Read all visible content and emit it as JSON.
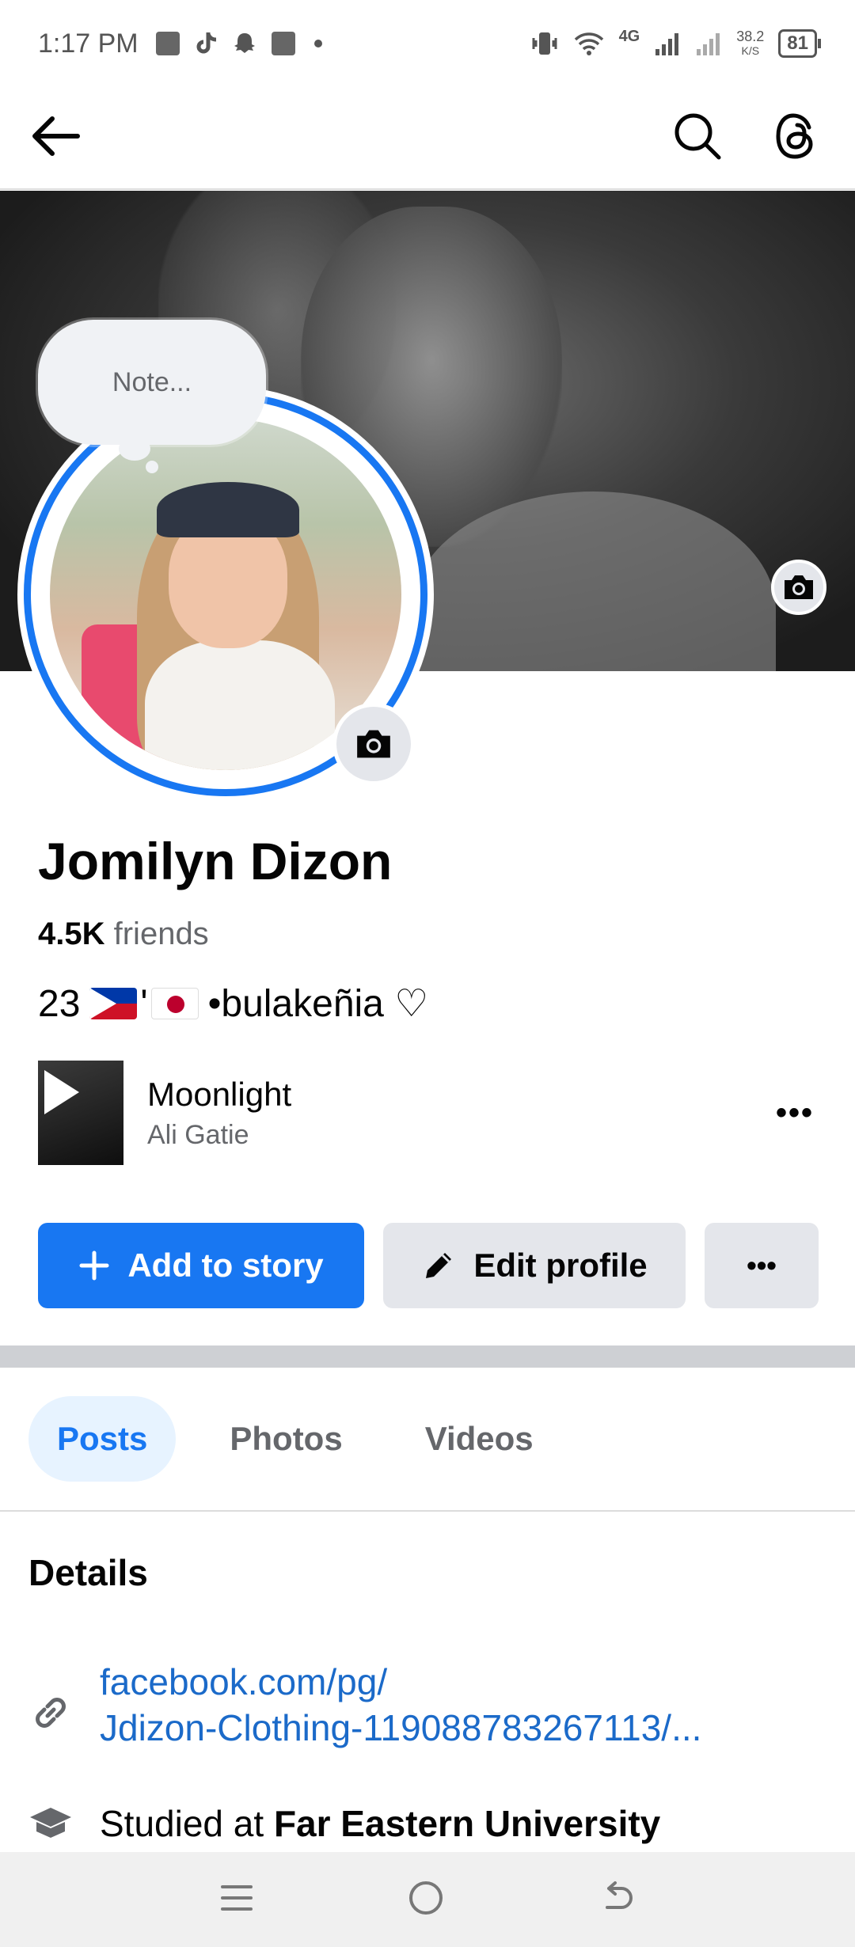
{
  "status": {
    "time": "1:17 PM",
    "network": "4G",
    "speed_value": "38.2",
    "speed_unit": "K/S",
    "battery": "81"
  },
  "profile": {
    "note_placeholder": "Note...",
    "name": "Jomilyn Dizon",
    "friends_count": "4.5K",
    "friends_label": "friends",
    "bio_age": "23",
    "bio_sep": "'",
    "bio_text": "•bulakeñia ♡"
  },
  "music": {
    "title": "Moonlight",
    "artist": "Ali Gatie",
    "more": "•••"
  },
  "actions": {
    "add_story": "Add to story",
    "edit_profile": "Edit profile",
    "more": "•••"
  },
  "tabs": [
    {
      "label": "Posts",
      "active": true
    },
    {
      "label": "Photos",
      "active": false
    },
    {
      "label": "Videos",
      "active": false
    }
  ],
  "details": {
    "title": "Details",
    "link_line1": "facebook.com/pg/",
    "link_line2": "Jdizon-Clothing-119088783267113/...",
    "education_prefix": "Studied at ",
    "education_school": "Far Eastern University"
  },
  "colors": {
    "accent": "#1877f2",
    "link": "#1b6ac9",
    "secondary_text": "#65676b",
    "button_gray": "#e4e6eb"
  },
  "icons": {
    "back": "arrow-left-icon",
    "search": "search-icon",
    "threads": "threads-icon",
    "camera": "camera-icon",
    "plus": "plus-icon",
    "pencil": "pencil-icon",
    "link": "link-icon",
    "education": "graduation-cap-icon"
  }
}
